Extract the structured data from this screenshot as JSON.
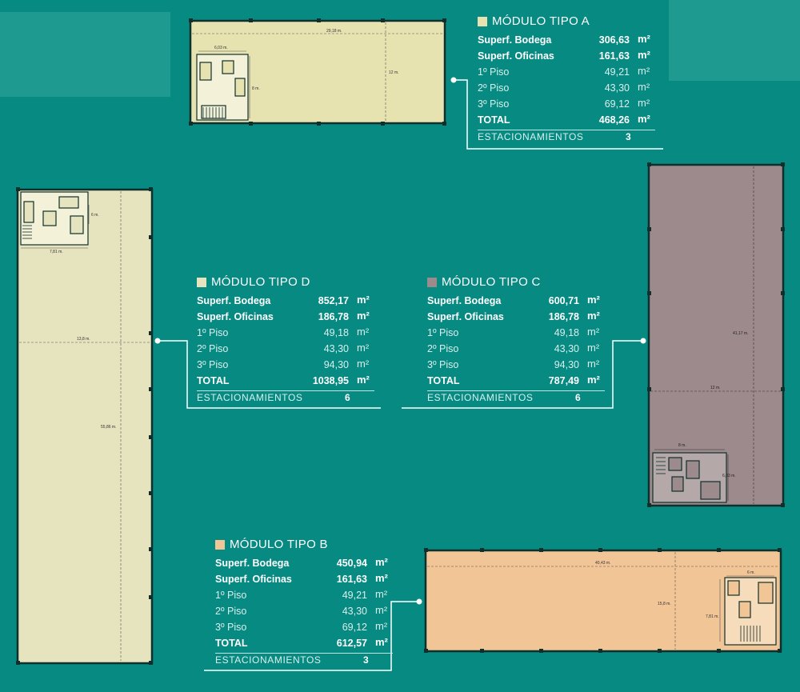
{
  "colors": {
    "background": "#078a82",
    "tipo_a": "#e7e3b1",
    "tipo_b": "#f1c596",
    "tipo_c": "#9c8a8c",
    "tipo_d": "#e6e3bf",
    "outline": "#0f2f2c",
    "line": "#ffffff"
  },
  "modules": {
    "a": {
      "title": "MÓDULO TIPO A",
      "rows": [
        {
          "label": "Superf. Bodega",
          "value": "306,63",
          "unit": "m²",
          "style": "bold"
        },
        {
          "label": "Superf. Oficinas",
          "value": "161,63",
          "unit": "m²",
          "style": "bold"
        },
        {
          "label": "1º Piso",
          "value": "49,21",
          "unit": "m²",
          "style": "lite"
        },
        {
          "label": "2º Piso",
          "value": "43,30",
          "unit": "m²",
          "style": "lite"
        },
        {
          "label": "3º Piso",
          "value": "69,12",
          "unit": "m²",
          "style": "lite"
        },
        {
          "label": "TOTAL",
          "value": "468,26",
          "unit": "m²",
          "style": "bold"
        }
      ],
      "parking_label": "ESTACIONAMIENTOS",
      "parking_value": "3",
      "plan_dims": {
        "width": "29,18 m.",
        "height": "12 m.",
        "office_w": "6,03 m.",
        "office_h": "8 m."
      }
    },
    "d": {
      "title": "MÓDULO TIPO D",
      "rows": [
        {
          "label": "Superf. Bodega",
          "value": "852,17",
          "unit": "m²",
          "style": "bold"
        },
        {
          "label": "Superf. Oficinas",
          "value": "186,78",
          "unit": "m²",
          "style": "bold"
        },
        {
          "label": "1º Piso",
          "value": "49,18",
          "unit": "m²",
          "style": "lite"
        },
        {
          "label": "2º Piso",
          "value": "43,30",
          "unit": "m²",
          "style": "lite"
        },
        {
          "label": "3º Piso",
          "value": "94,30",
          "unit": "m²",
          "style": "lite"
        },
        {
          "label": "TOTAL",
          "value": "1038,95",
          "unit": "m²",
          "style": "bold"
        }
      ],
      "parking_label": "ESTACIONAMIENTOS",
      "parking_value": "6",
      "plan_dims": {
        "width": "13,8 m.",
        "height": "55,86 m.",
        "office_w": "7,81 m.",
        "office_h": "6 m."
      }
    },
    "c": {
      "title": "MÓDULO TIPO C",
      "rows": [
        {
          "label": "Superf. Bodega",
          "value": "600,71",
          "unit": "m²",
          "style": "bold"
        },
        {
          "label": "Superf. Oficinas",
          "value": "186,78",
          "unit": "m²",
          "style": "bold"
        },
        {
          "label": "1º Piso",
          "value": "49,18",
          "unit": "m²",
          "style": "lite"
        },
        {
          "label": "2º Piso",
          "value": "43,30",
          "unit": "m²",
          "style": "lite"
        },
        {
          "label": "3º Piso",
          "value": "94,30",
          "unit": "m²",
          "style": "lite"
        },
        {
          "label": "TOTAL",
          "value": "787,49",
          "unit": "m²",
          "style": "bold"
        }
      ],
      "parking_label": "ESTACIONAMIENTOS",
      "parking_value": "6",
      "plan_dims": {
        "width": "12 m.",
        "height": "41,17 m.",
        "office_w": "8 m.",
        "office_h": "6,03 m."
      }
    },
    "b": {
      "title": "MÓDULO TIPO B",
      "rows": [
        {
          "label": "Superf. Bodega",
          "value": "450,94",
          "unit": "m²",
          "style": "bold"
        },
        {
          "label": "Superf. Oficinas",
          "value": "161,63",
          "unit": "m²",
          "style": "bold"
        },
        {
          "label": "1º Piso",
          "value": "49,21",
          "unit": "m²",
          "style": "lite"
        },
        {
          "label": "2º Piso",
          "value": "43,30",
          "unit": "m²",
          "style": "lite"
        },
        {
          "label": "3º Piso",
          "value": "69,12",
          "unit": "m²",
          "style": "lite"
        },
        {
          "label": "TOTAL",
          "value": "612,57",
          "unit": "m²",
          "style": "bold"
        }
      ],
      "parking_label": "ESTACIONAMIENTOS",
      "parking_value": "3",
      "plan_dims": {
        "width": "40,43 m.",
        "height": "15,8 m.",
        "office_w": "6 m.",
        "office_h": "7,81 m."
      }
    }
  }
}
